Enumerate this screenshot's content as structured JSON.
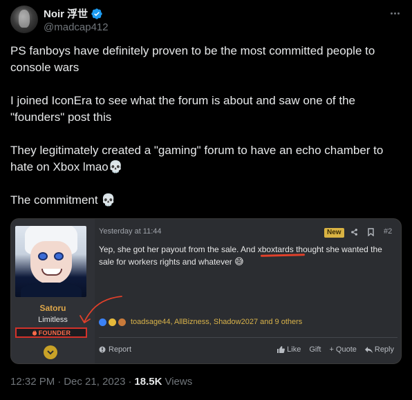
{
  "author": {
    "display_name": "Noir 浮世",
    "handle": "@madcap412"
  },
  "tweet": {
    "paragraphs": [
      "PS fanboys have definitely proven to be the most committed people to console wars",
      "I joined IconEra to see what the forum is about and saw one of the \"founders\" post this",
      "They legitimately created a \"gaming\" forum to have an echo chamber to hate on Xbox lmao💀",
      "The commitment 💀"
    ]
  },
  "forum_post": {
    "username": "Satoru",
    "user_title": "Limitless",
    "badge": "FOUNDER",
    "timestamp": "Yesterday at 11:44",
    "new_label": "New",
    "post_number": "#2",
    "body_before": "Yep, she got her payout from the sale. And ",
    "body_highlight": "xboxtards",
    "body_after": " thought she wanted the sale for workers rights and whatever",
    "body_emoji": "😅",
    "reactions_text": "toadsage44, AllBizness, Shadow2027 and 9 others",
    "report_label": "Report",
    "like_label": "Like",
    "gift_label": "Gift",
    "quote_label": "Quote",
    "reply_label": "Reply"
  },
  "meta": {
    "time": "12:32 PM",
    "separator": "·",
    "date": "Dec 21, 2023",
    "views_count": "18.5K",
    "views_label": "Views"
  },
  "colors": {
    "background": "#000000",
    "verified": "#1d9bf0",
    "forum_username": "#e0a84a",
    "founder_badge": "#d4322a",
    "new_badge": "#d9b343",
    "annotation_red": "#e0402a"
  },
  "icons": [
    "verified-badge-icon",
    "more-icon",
    "share-icon",
    "bookmark-icon",
    "report-icon",
    "like-icon",
    "quote-plus-icon",
    "reply-icon",
    "chevron-down-icon",
    "flame-icon"
  ]
}
